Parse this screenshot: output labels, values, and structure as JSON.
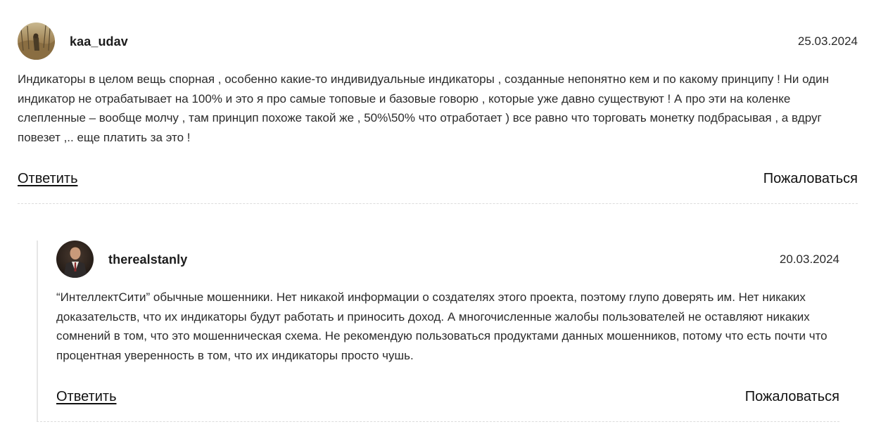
{
  "comments": [
    {
      "username": "kaa_udav",
      "date": "25.03.2024",
      "text": "Индикаторы в целом вещь спорная , особенно какие-то индивидуальные индикаторы , созданные непонятно кем и по какому принципу ! Ни один индикатор не отрабатывает на 100% и это я про самые топовые и базовые говорю , которые уже давно существуют ! А про эти на коленке слепленные – вообще молчу , там принцип похоже такой же , 50%\\50% что отработает ) все равно что торговать монетку подбрасывая , а вдруг повезет ,.. еще платить за это !",
      "reply_label": "Ответить",
      "complain_label": "Пожаловаться"
    },
    {
      "username": "therealstanly",
      "date": "20.03.2024",
      "text": "“ИнтеллектСити” обычные мошенники. Нет никакой информации о создателях этого проекта, поэтому глупо доверять им. Нет никаких доказательств, что их индикаторы будут работать и приносить доход. А многочисленные жалобы пользователей не оставляют никаких сомнений в том, что это мошенническая схема. Не рекомендую пользоваться продуктами данных мошенников, потому что есть почти что процентная уверенность в том, что их индикаторы просто чушь.",
      "reply_label": "Ответить",
      "complain_label": "Пожаловаться"
    }
  ]
}
